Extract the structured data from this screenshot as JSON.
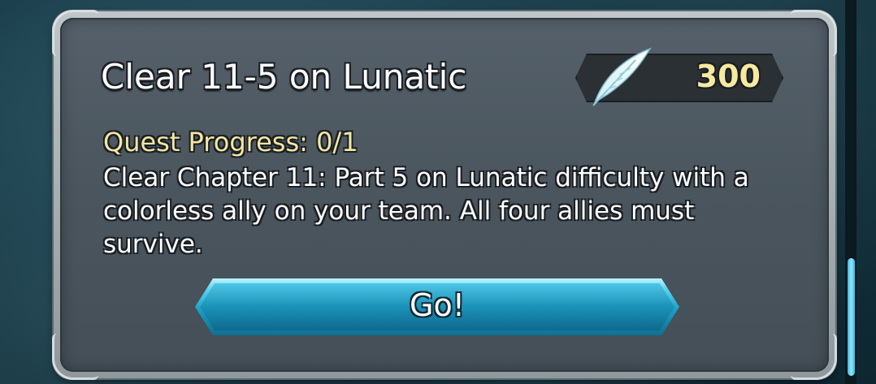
{
  "quest": {
    "title": "Clear 11-5 on Lunatic",
    "progress_text": "Quest Progress: 0/1",
    "description": "Clear Chapter 11: Part 5 on Lunatic difficulty with a colorless ally on your team. All four allies must survive."
  },
  "reward": {
    "icon": "feather-icon",
    "amount": "300"
  },
  "actions": {
    "go_label": "Go!"
  },
  "scrollbar": {
    "position": 0.86
  },
  "colors": {
    "panel": "#4a555d",
    "highlight_text": "#f3e6a2",
    "button": "#1a92b8"
  }
}
